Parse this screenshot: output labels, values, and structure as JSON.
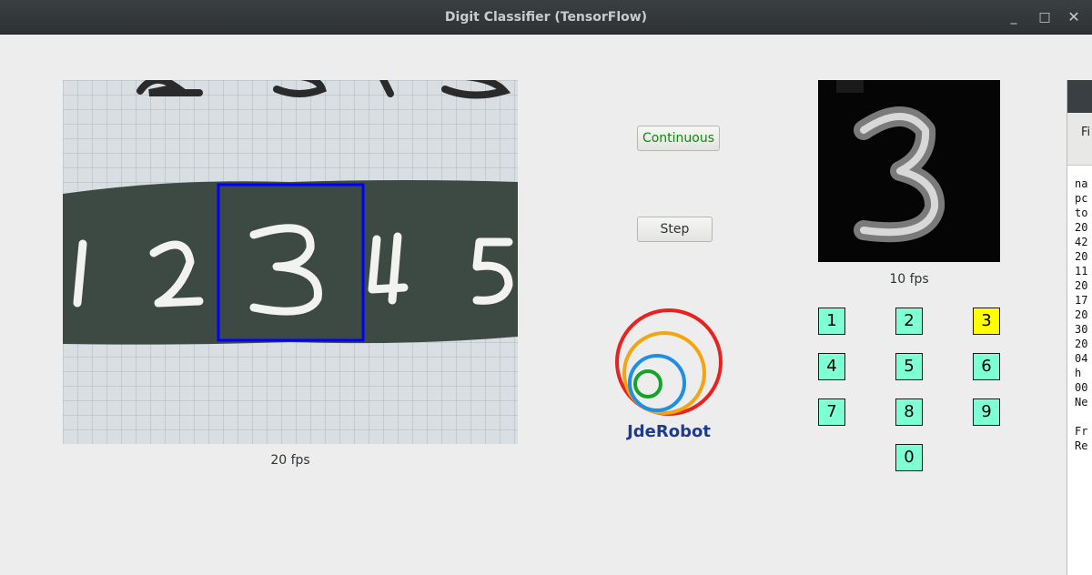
{
  "window": {
    "title": "Digit Classifier (TensorFlow)",
    "minimize_glyph": "_",
    "maximize_glyph": "□",
    "close_glyph": "✕"
  },
  "camera": {
    "fps_label": "20 fps",
    "detection_box_color": "#0000ff"
  },
  "controls": {
    "continuous_label": "Continuous",
    "step_label": "Step"
  },
  "logo": {
    "text": "JdeRobot",
    "ring_colors": [
      "#e8231f",
      "#f5a411",
      "#1f8fe6",
      "#16a32a"
    ],
    "text_color": "#1f3b8e"
  },
  "digit_view": {
    "fps_label": "10 fps"
  },
  "digits": {
    "items": [
      "1",
      "2",
      "3",
      "4",
      "5",
      "6",
      "7",
      "8",
      "9",
      "0"
    ],
    "predicted": "3",
    "box_color": "#7fffd4",
    "highlight_color": "#ffff00"
  },
  "side_window": {
    "menu_text": "Fi",
    "terminal_lines": [
      "na",
      "pc",
      "to",
      "20",
      "42",
      "20",
      "11",
      "20",
      "17",
      "20",
      "30",
      "20",
      "04",
      "h",
      "00",
      "Ne",
      "",
      "Fr",
      "Re"
    ]
  }
}
